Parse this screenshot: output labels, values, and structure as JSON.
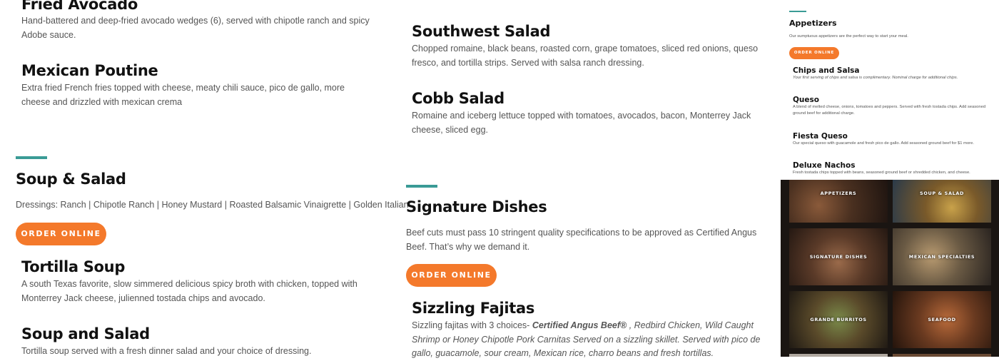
{
  "left_column": {
    "fried_avocado": {
      "title": "Fried Avocado",
      "desc": "Hand-battered and deep-fried avocado wedges (6), served with chipotle ranch and spicy Adobe sauce."
    },
    "mexican_poutine": {
      "title": "Mexican Poutine",
      "desc": "Extra fried French fries topped with cheese, meaty chili sauce, pico de gallo, more cheese and drizzled with mexican crema"
    },
    "soup_salad_section": {
      "title": "Soup & Salad",
      "dressings": "Dressings: Ranch | Chipotle Ranch | Honey Mustard | Roasted Balsamic Vinaigrette | Golden Italian",
      "button": "ORDER ONLINE"
    },
    "tortilla_soup": {
      "title": "Tortilla Soup",
      "desc": "A south Texas favorite, slow simmered delicious spicy broth with chicken, topped with Monterrey Jack cheese, julienned tostada chips and avocado."
    },
    "soup_and_salad": {
      "title": "Soup and Salad",
      "desc": "Tortilla soup served with a fresh dinner salad and your choice of dressing."
    }
  },
  "middle_column": {
    "southwest_salad": {
      "title": "Southwest Salad",
      "desc": "Chopped romaine, black beans, roasted corn, grape tomatoes, sliced red onions, queso fresco, and tortilla strips. Served with salsa ranch dressing."
    },
    "cobb_salad": {
      "title": "Cobb Salad",
      "desc": "Romaine and iceberg lettuce topped with tomatoes, avocados, bacon, Monterrey Jack cheese, sliced egg."
    },
    "signature_section": {
      "title": "Signature Dishes",
      "desc": "Beef cuts must pass 10 stringent quality specifications to be approved as Certified Angus Beef. That’s why we demand it.",
      "button": "ORDER ONLINE"
    },
    "sizzling_fajitas": {
      "title": "Sizzling Fajitas",
      "desc_lead": "Sizzling fajitas with 3 choices-",
      "desc_bold": "Certified Angus Beef®",
      "desc_rest": ", Redbird Chicken, Wild Caught Shrimp or Honey Chipotle Pork Carnitas Served on a sizzling skillet. Served with pico de gallo, guacamole, sour cream, Mexican rice, charro beans and fresh tortillas."
    }
  },
  "right_panel": {
    "appetizers": {
      "title": "Appetizers",
      "desc": "Our sumptuous appetizers are the perfect way to start your meal.",
      "button": "ORDER ONLINE"
    },
    "items": [
      {
        "title": "Chips and Salsa",
        "desc": "Your first serving of chips and salsa is complimentary. Nominal charge for additional chips."
      },
      {
        "title": "Queso",
        "desc": "A blend of melted cheese, onions, tomatoes and peppers. Served with fresh tostada chips. Add seasoned ground beef for additional charge."
      },
      {
        "title": "Fiesta Queso",
        "desc": "Our special queso with guacamole and fresh pico de gallo. Add seasoned ground beef for $1 more."
      },
      {
        "title": "Deluxe Nachos",
        "desc": "Fresh tostada chips topped with beans, seasoned ground beef or shredded chicken, and cheese."
      }
    ],
    "tiles": [
      {
        "label": "APPETIZERS"
      },
      {
        "label": "SOUP & SALAD"
      },
      {
        "label": "SIGNATURE DISHES"
      },
      {
        "label": "MEXICAN SPECIALTIES"
      },
      {
        "label": "GRANDE BURRITOS"
      },
      {
        "label": "SEAFOOD"
      }
    ]
  },
  "colors": {
    "accent_orange": "#f4792b",
    "accent_teal": "#3a9b96"
  }
}
